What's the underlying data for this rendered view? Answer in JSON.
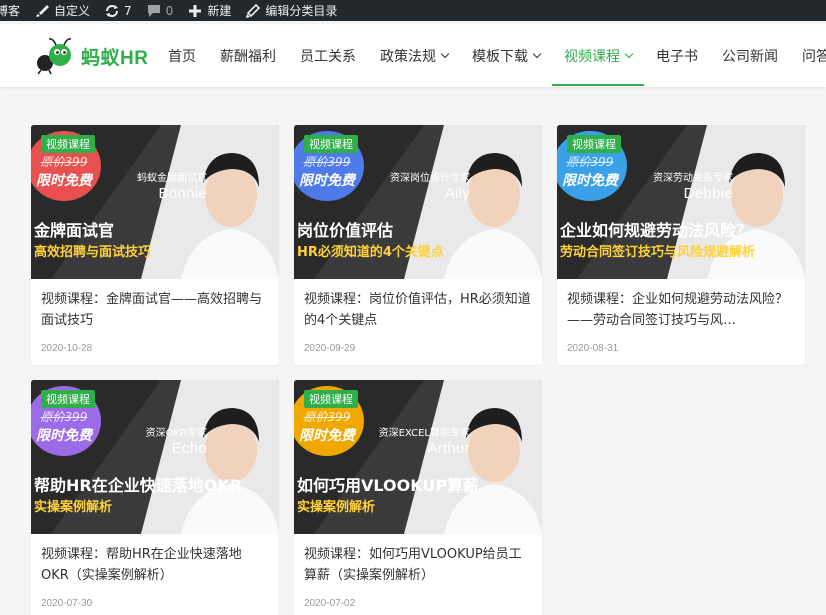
{
  "adminbar": {
    "site_fragment": "博客",
    "customize": "自定义",
    "updates_count": "7",
    "comments_count": "0",
    "new_label": "新建",
    "edit_category": "编辑分类目录"
  },
  "logo": {
    "text": "蚂蚁HR"
  },
  "nav": [
    {
      "label": "首页",
      "dropdown": false,
      "active": false
    },
    {
      "label": "薪酬福利",
      "dropdown": false,
      "active": false
    },
    {
      "label": "员工关系",
      "dropdown": false,
      "active": false
    },
    {
      "label": "政策法规",
      "dropdown": true,
      "active": false
    },
    {
      "label": "模板下载",
      "dropdown": true,
      "active": false
    },
    {
      "label": "视频课程",
      "dropdown": true,
      "active": true
    },
    {
      "label": "电子书",
      "dropdown": false,
      "active": false
    },
    {
      "label": "公司新闻",
      "dropdown": false,
      "active": false
    },
    {
      "label": "问答",
      "dropdown": false,
      "active": false
    }
  ],
  "colors": {
    "brand": "#2fae4a",
    "thumb_dark": "#3a3a3a"
  },
  "cards": [
    {
      "tag": "视频课程",
      "promo_original": "原价399",
      "promo_free": "限时免费",
      "promo_color": "#e8504f",
      "speaker_role": "蚂蚁金牌面试官",
      "speaker_name": "Bonnie",
      "headline": "金牌面试官",
      "subline": "高效招聘与面试技巧",
      "subline_color": "#ffd23a",
      "title": "视频课程：金牌面试官——高效招聘与面试技巧",
      "date": "2020-10-28"
    },
    {
      "tag": "视频课程",
      "promo_original": "原价399",
      "promo_free": "限时免费",
      "promo_color": "#4f7be8",
      "speaker_role": "资深岗位设计专家",
      "speaker_name": "Aily",
      "headline": "岗位价值评估",
      "subline": "HR必须知道的4个关键点",
      "subline_color": "#ffd23a",
      "title": "视频课程：岗位价值评估，HR必须知道的4个关键点",
      "date": "2020-09-29"
    },
    {
      "tag": "视频课程",
      "promo_original": "原价399",
      "promo_free": "限时免费",
      "promo_color": "#3aa0e8",
      "speaker_role": "资深劳动关系专家",
      "speaker_name": "Debbie",
      "headline": "企业如何规避劳动法风险？",
      "subline": "劳动合同签订技巧与风险规避解析",
      "subline_color": "#ffd23a",
      "title": "视频课程：企业如何规避劳动法风险？——劳动合同签订技巧与风…",
      "date": "2020-08-31"
    },
    {
      "tag": "视频课程",
      "promo_original": "原价399",
      "promo_free": "限时免费",
      "promo_color": "#9b6be8",
      "speaker_role": "资深OKR专家",
      "speaker_name": "Echo",
      "headline": "帮助HR在企业快速落地OKR",
      "subline": "实操案例解析",
      "subline_color": "#ffd23a",
      "title": "视频课程：帮助HR在企业快速落地OKR（实操案例解析）",
      "date": "2020-07-30"
    },
    {
      "tag": "视频课程",
      "promo_original": "原价399",
      "promo_free": "限时免费",
      "promo_color": "#f0a800",
      "speaker_role": "资深EXCEL算薪专家",
      "speaker_name": "Arthur",
      "headline": "如何巧用VLOOKUP算薪",
      "subline": "实操案例解析",
      "subline_color": "#ffd23a",
      "title": "视频课程：如何巧用VLOOKUP给员工算薪（实操案例解析）",
      "date": "2020-07-02"
    }
  ]
}
